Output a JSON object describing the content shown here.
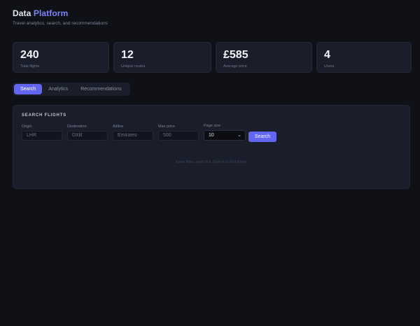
{
  "header": {
    "title_part1": "Data",
    "title_part2": "Platform",
    "subtitle": "Travel analytics, search, and recommendations"
  },
  "stats": [
    {
      "value": "240",
      "label": "Total flights"
    },
    {
      "value": "12",
      "label": "Unique routes"
    },
    {
      "value": "£585",
      "label": "Average price"
    },
    {
      "value": "4",
      "label": "Users"
    }
  ],
  "tabs": [
    {
      "label": "Search",
      "active": true
    },
    {
      "label": "Analytics",
      "active": false
    },
    {
      "label": "Recommendations",
      "active": false
    }
  ],
  "search": {
    "title": "SEARCH FLIGHTS",
    "origin": {
      "label": "Origin",
      "placeholder": "LHR"
    },
    "destination": {
      "label": "Destination",
      "placeholder": "DXB"
    },
    "airline": {
      "label": "Airline",
      "placeholder": "Emirates"
    },
    "max_price": {
      "label": "Max price",
      "placeholder": "500"
    },
    "page_size": {
      "label": "Page size",
      "value": "10"
    },
    "button_label": "Search",
    "empty_text": "Enter filters and click Search to find flights"
  },
  "colors": {
    "accent": "#6366f1",
    "background": "#0f1117",
    "card": "#1a1e2b"
  }
}
